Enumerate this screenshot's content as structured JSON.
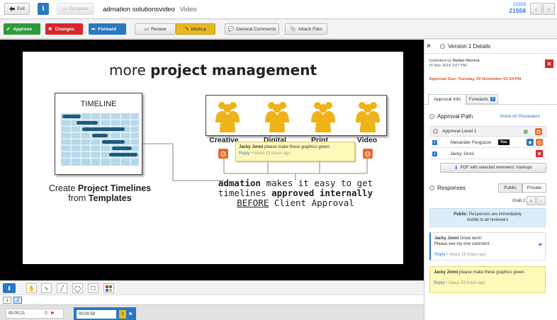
{
  "topbar": {
    "exit_label": "Exit",
    "compare_label": "Compare",
    "title": "admation solutionsvideo",
    "subtitle": "Video",
    "version_small": "21559",
    "version_big": "21558"
  },
  "actions": {
    "approve": "Approve",
    "changes": "Changes",
    "forward": "Forward",
    "review": "Review",
    "markup": "Markup",
    "general_comments": "General Comments",
    "attach_files": "Attach Files"
  },
  "slide": {
    "heading_light": "more ",
    "heading_bold": "project management",
    "timeline_label": "TIMELINE",
    "caption_left_1a": "Create ",
    "caption_left_1b": "Project Timelines",
    "caption_left_2a": "from ",
    "caption_left_2b": "Templates",
    "channels": [
      "Creative",
      "Digital",
      "Print",
      "Video"
    ],
    "caption_right_1a": "admation",
    "caption_right_1b": " makes it easy to get",
    "caption_right_2a": "timelines ",
    "caption_right_2b": "approved internally",
    "caption_right_3a": "BEFORE",
    "caption_right_3b": " Client Approval",
    "bubble_name": "Jacky Jonni",
    "bubble_text": "please make these graphics green",
    "bubble_reply": "Reply",
    "bubble_ago": "About 19 hours ago"
  },
  "pages": [
    "1",
    "2"
  ],
  "timeline": {
    "item1_time": "00:00:21",
    "item1_count": "0",
    "item2_time": "00:00:58",
    "item2_count": "1"
  },
  "panel": {
    "version_title": "Version 1 Details",
    "submitted_label": "Submitted by ",
    "submitted_by": "Stefan Herrera",
    "submitted_date": "15 Nov 2018 2:07 PM",
    "approval_due": "Approval Due: Tuesday, 20 November 02:54 PM",
    "tab_approval": "Approval Info",
    "tab_forwards": "Forwards",
    "forwards_count": "0",
    "approval_path": "Approval Path",
    "show_all": "Show All Reviewers",
    "level": "Approval Level 1",
    "reviewer1": "Alexander Ferguson",
    "you_badge": "You",
    "reviewer2": "Jacky Jonni",
    "pdf_button": "PDF with selected reviewers' markups",
    "responses": "Responses",
    "public": "Public",
    "private": "Private",
    "grab": "Grab 2",
    "public_note_bold": "Public:",
    "public_note_1": " Responses are immediately",
    "public_note_2": "visible to all reviewers",
    "comments": [
      {
        "name": "Jacky Jonni",
        "line1": "Great work!",
        "line2": "Please see my one comment.",
        "reply": "Reply",
        "ago": "About 19 hours ago"
      },
      {
        "name": "Jacky Jonni",
        "line1": "please make these graphics green",
        "line2": "",
        "reply": "Reply",
        "ago": "About 19 hours ago"
      }
    ]
  },
  "colors": {
    "approve": "#2f9a3a",
    "changes": "#d9252b",
    "forward": "#2a78c2",
    "markup": "#e8b820",
    "accent": "#2a7bd6",
    "due": "#e2541b",
    "chart_blue": "#1e5a7a",
    "chart_light": "#b6d8ea",
    "person_yellow": "#f0b21a"
  }
}
